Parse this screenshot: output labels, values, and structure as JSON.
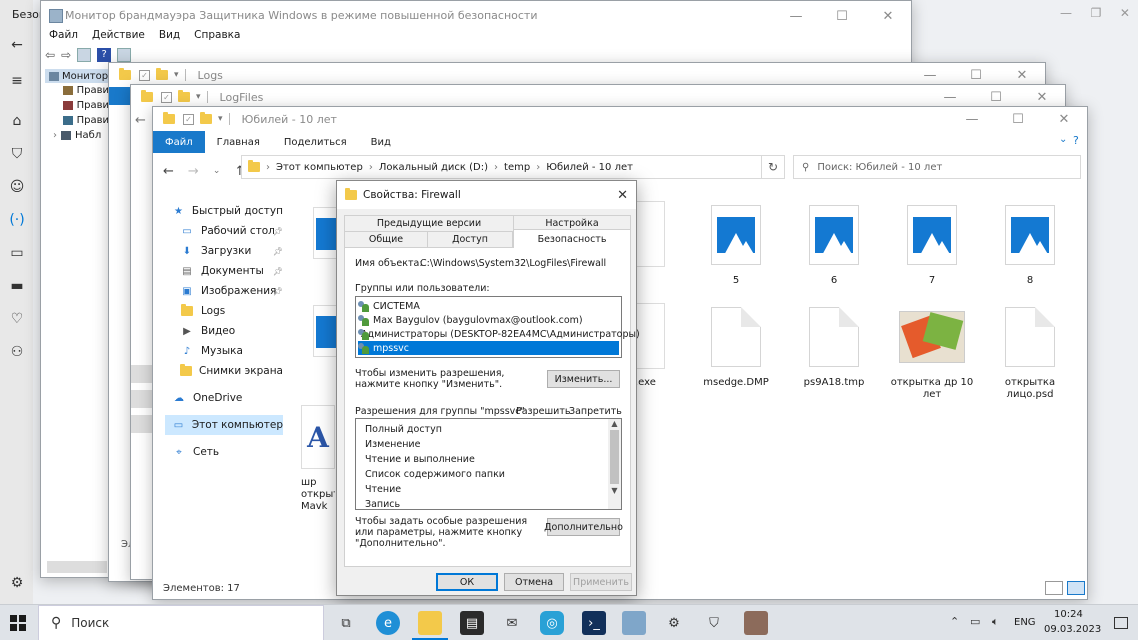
{
  "desktop": {
    "settings_title": "Безопас"
  },
  "firewall_window": {
    "title": "Монитор брандмауэра Защитника Windows в режиме повышенной безопасности",
    "menu": [
      "Файл",
      "Действие",
      "Вид",
      "Справка"
    ],
    "tree": [
      "Монитор",
      "Прави",
      "Прави",
      "Прави",
      "Набл"
    ]
  },
  "logs_window": {
    "title": "Logs",
    "status": "Эл"
  },
  "logfiles_window": {
    "title": "LogFiles",
    "status": "Эл"
  },
  "explorer": {
    "title": "Юбилей - 10 лет",
    "ribbon_tabs": [
      "Файл",
      "Главная",
      "Поделиться",
      "Вид"
    ],
    "address": [
      "Этот компьютер",
      "Локальный диск (D:)",
      "temp",
      "Юбилей - 10 лет"
    ],
    "search_placeholder": "Поиск: Юбилей - 10 лет",
    "nav": [
      {
        "label": "Быстрый доступ",
        "icon": "star-icon"
      },
      {
        "label": "Рабочий стол",
        "icon": "desktop-icon",
        "pinned": true
      },
      {
        "label": "Загрузки",
        "icon": "download-icon",
        "pinned": true
      },
      {
        "label": "Документы",
        "icon": "document-icon",
        "pinned": true
      },
      {
        "label": "Изображения",
        "icon": "pictures-icon",
        "pinned": true
      },
      {
        "label": "Logs",
        "icon": "folder-icon"
      },
      {
        "label": "Видео",
        "icon": "video-icon"
      },
      {
        "label": "Музыка",
        "icon": "music-icon"
      },
      {
        "label": "Снимки экрана",
        "icon": "folder-icon"
      },
      {
        "label": "OneDrive",
        "icon": "cloud-icon"
      },
      {
        "label": "Этот компьютер",
        "icon": "computer-icon",
        "selected": true
      },
      {
        "label": "Сеть",
        "icon": "network-icon"
      }
    ],
    "files": [
      {
        "name": "5",
        "type": "image"
      },
      {
        "name": "6",
        "type": "image"
      },
      {
        "name": "7",
        "type": "image"
      },
      {
        "name": "8",
        "type": "image"
      },
      {
        "name": ".exe",
        "type": "partial"
      },
      {
        "name": "msedge.DMP",
        "type": "doc"
      },
      {
        "name": "ps9A18.tmp",
        "type": "doc"
      },
      {
        "name": "открытка др 10 лет",
        "type": "photo"
      },
      {
        "name": "открытка лицо.psd",
        "type": "doc"
      }
    ],
    "partial_file_lines": [
      "шр",
      "открыт",
      "Mavk"
    ],
    "status": "Элементов: 17"
  },
  "dialog": {
    "title": "Свойства: Firewall",
    "tabs_top": [
      "Предыдущие версии",
      "Настройка"
    ],
    "tabs_bottom": [
      "Общие",
      "Доступ",
      "Безопасность"
    ],
    "object_label": "Имя объекта:",
    "object_value": "C:\\Windows\\System32\\LogFiles\\Firewall",
    "groups_label": "Группы или пользователи:",
    "users": [
      "СИСТЕМА",
      "Max Baygulov (baygulovmax@outlook.com)",
      "Администраторы (DESKTOP-82EA4MC\\Администраторы)",
      "mpssvc"
    ],
    "change_hint": "Чтобы изменить разрешения, нажмите кнопку \"Изменить\".",
    "change_button": "Изменить...",
    "perm_label": "Разрешения для группы \"mpssvc\"",
    "allow": "Разрешить",
    "deny": "Запретить",
    "permissions": [
      "Полный доступ",
      "Изменение",
      "Чтение и выполнение",
      "Список содержимого папки",
      "Чтение",
      "Запись"
    ],
    "advanced_hint": "Чтобы задать особые разрешения или параметры, нажмите кнопку \"Дополнительно\".",
    "advanced_button": "Дополнительно",
    "ok": "ОК",
    "cancel": "Отмена",
    "apply": "Применить"
  },
  "taskbar": {
    "search": "Поиск",
    "lang": "ENG",
    "time": "10:24",
    "date": "09.03.2023"
  },
  "colors": {
    "accent": "#0078d7",
    "file_tab": "#1979ca",
    "selection": "#0078d7"
  }
}
